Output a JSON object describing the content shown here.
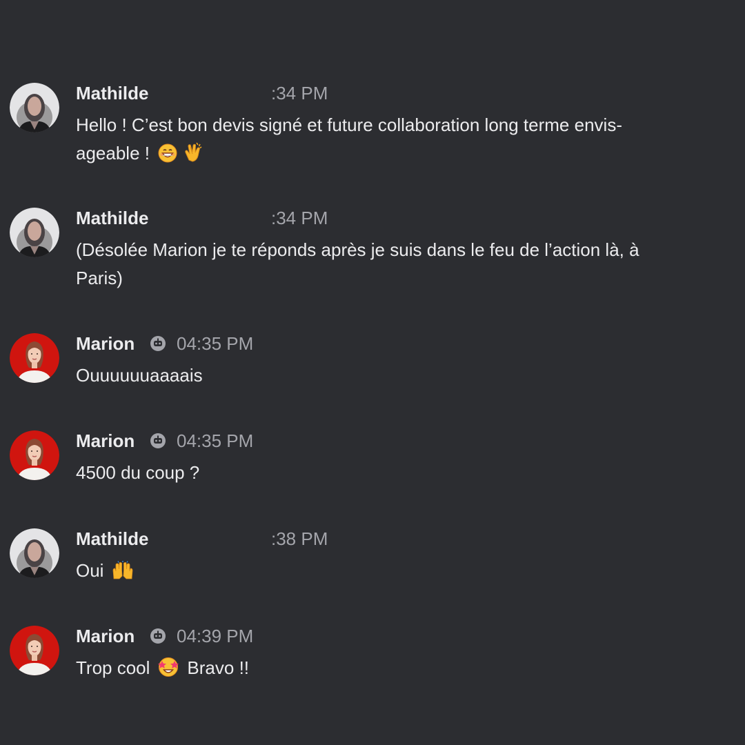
{
  "colors": {
    "background": "#2c2d31",
    "text": "#ececee",
    "timestamp": "#a4a5ab",
    "marion_avatar_bg": "#d0150f"
  },
  "messages": [
    {
      "author": "Mathilde",
      "time": ":34 PM",
      "text_before": "Hello ! C’est bon devis signé et future collaboration long terme envis-\nageable !",
      "emojis": [
        "grinning-face-emoji",
        "clapping-hands-emoji"
      ],
      "text_after": ""
    },
    {
      "author": "Mathilde",
      "time": ":34 PM",
      "text_before": "(Désolée Marion je te réponds après je suis dans le feu de l’action là, à\nParis)",
      "emojis": [],
      "text_after": ""
    },
    {
      "author": "Marion",
      "badge": "bot-badge-icon",
      "time": "04:35 PM",
      "text_before": "Ouuuuuuaaaais",
      "emojis": [],
      "text_after": ""
    },
    {
      "author": "Marion",
      "badge": "bot-badge-icon",
      "time": "04:35 PM",
      "text_before": "4500 du coup ?",
      "emojis": [],
      "text_after": ""
    },
    {
      "author": "Mathilde",
      "time": ":38 PM",
      "text_before": "Oui",
      "emojis": [
        "raising-hands-emoji"
      ],
      "text_after": ""
    },
    {
      "author": "Marion",
      "badge": "bot-badge-icon",
      "time": "04:39 PM",
      "text_before": "Trop cool",
      "emojis": [
        "star-struck-emoji"
      ],
      "text_after": "Bravo !!"
    }
  ]
}
